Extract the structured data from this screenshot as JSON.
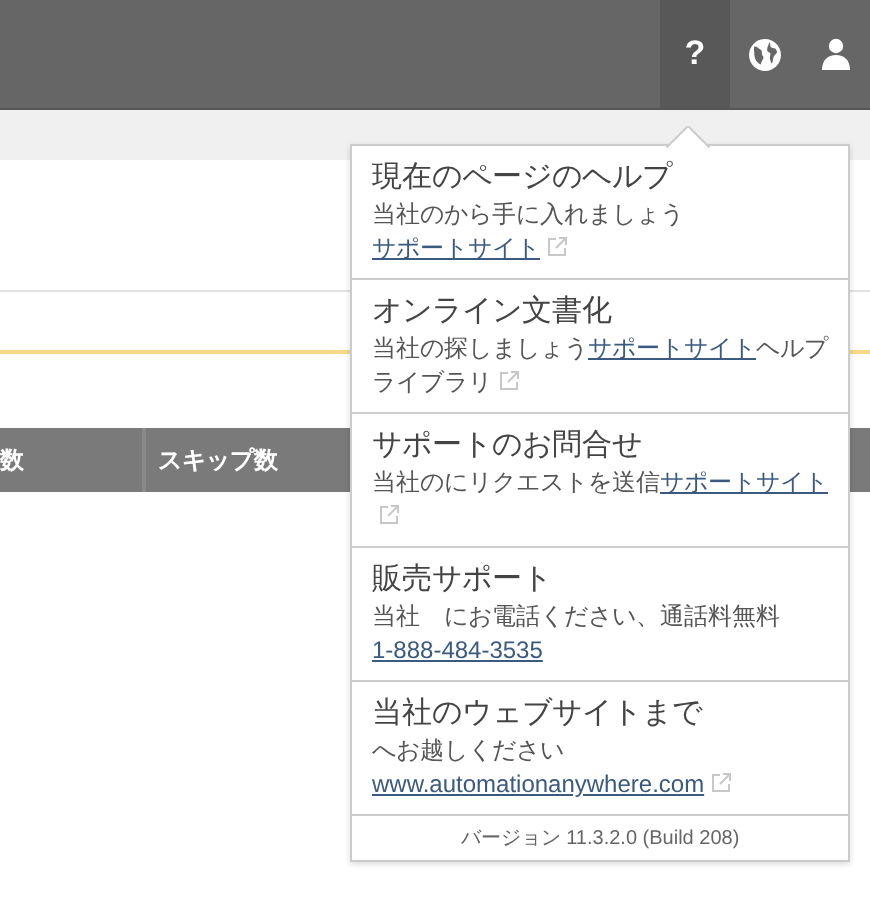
{
  "top_bar": {
    "buttons": [
      {
        "kind": "help",
        "label": "?",
        "selected": true
      },
      {
        "kind": "globe",
        "selected": false
      },
      {
        "kind": "user",
        "selected": false
      }
    ]
  },
  "background": {
    "table": {
      "columns": [
        "数",
        "スキップ数"
      ]
    }
  },
  "help_menu": {
    "items": [
      {
        "title": "現在のページのヘルプ",
        "text": "当社のから手に入れましょう",
        "link": "サポートサイト",
        "external": true
      },
      {
        "title": "オンライン文書化",
        "text": "当社の探しましょう",
        "link": "サポートサイト",
        "text_after": "ヘルプライブラリ",
        "external": true
      },
      {
        "title": "サポートのお問合せ",
        "text": "当社のにリクエストを送信",
        "link": "サポートサイト",
        "external": true
      },
      {
        "title": "販売サポート",
        "text": "当社　にお電話ください、通話料無料　",
        "link": "1-888-484-3535",
        "external": false
      },
      {
        "title": "当社のウェブサイトまで",
        "text": "へお越しください",
        "link": "www.automationanywhere.com",
        "external": true
      }
    ],
    "version": "バージョン 11.3.2.0 (Build 208)"
  }
}
